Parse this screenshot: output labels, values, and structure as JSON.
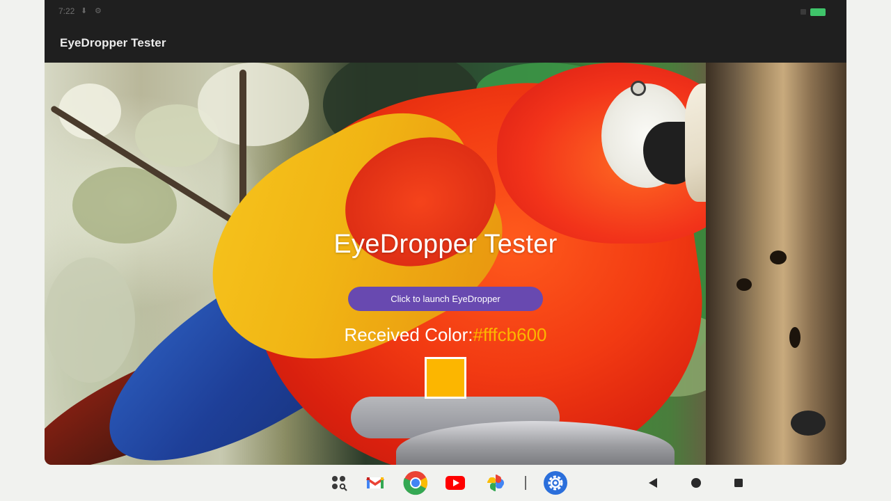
{
  "status_bar": {
    "time": "7:22",
    "icons": [
      "download-icon",
      "settings-icon"
    ]
  },
  "app_bar": {
    "title": "EyeDropper Tester"
  },
  "main": {
    "title": "EyeDropper Tester",
    "launch_button_label": "Click to launch EyeDropper",
    "received_label": "Received Color:",
    "received_value": "#fffcb600",
    "swatch_color": "#fcb600"
  },
  "taskbar": {
    "apps": [
      "app-drawer-icon",
      "gmail-icon",
      "chrome-icon",
      "youtube-icon",
      "photos-icon",
      "settings-icon"
    ],
    "nav": [
      "back-icon",
      "home-icon",
      "recents-icon"
    ]
  },
  "colors": {
    "button": "#6849b0",
    "accent": "#fcb600",
    "app_bar": "#1f1f1f"
  }
}
